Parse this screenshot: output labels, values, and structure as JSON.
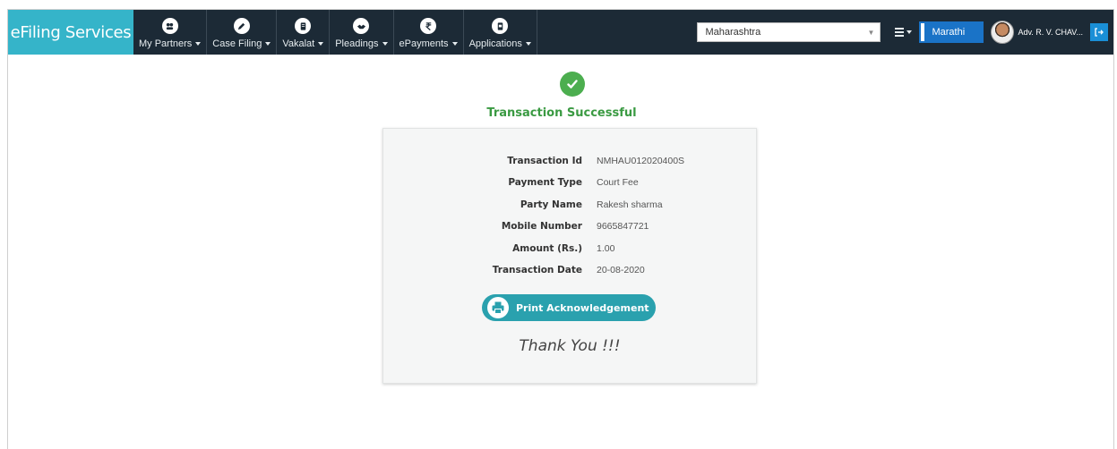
{
  "navbar": {
    "brand": "eFiling Services",
    "menu": [
      {
        "label": "My Partners",
        "icon": "partners-icon"
      },
      {
        "label": "Case Filing",
        "icon": "pencil-icon"
      },
      {
        "label": "Vakalat",
        "icon": "document-icon"
      },
      {
        "label": "Pleadings",
        "icon": "handshake-icon"
      },
      {
        "label": "ePayments",
        "icon": "rupee-icon"
      },
      {
        "label": "Applications",
        "icon": "file-icon"
      }
    ],
    "state_select": {
      "value": "Maharashtra"
    },
    "language_button": "Marathi",
    "user_name": "Adv. R. V. CHAV..."
  },
  "status": {
    "title": "Transaction Successful",
    "success_color": "#4cae4f"
  },
  "details": [
    {
      "label": "Transaction Id",
      "value": "NMHAU012020400S"
    },
    {
      "label": "Payment Type",
      "value": "Court Fee"
    },
    {
      "label": "Party Name",
      "value": "Rakesh sharma"
    },
    {
      "label": "Mobile Number",
      "value": "9665847721"
    },
    {
      "label": "Amount (Rs.)",
      "value": "1.00"
    },
    {
      "label": "Transaction Date",
      "value": "20-08-2020"
    }
  ],
  "print_button": "Print Acknowledgement",
  "thank_you": "Thank You !!!",
  "colors": {
    "brand": "#35b4c9",
    "navbar": "#1c2a36",
    "accent": "#2aa1ae",
    "language": "#1a73c7"
  }
}
